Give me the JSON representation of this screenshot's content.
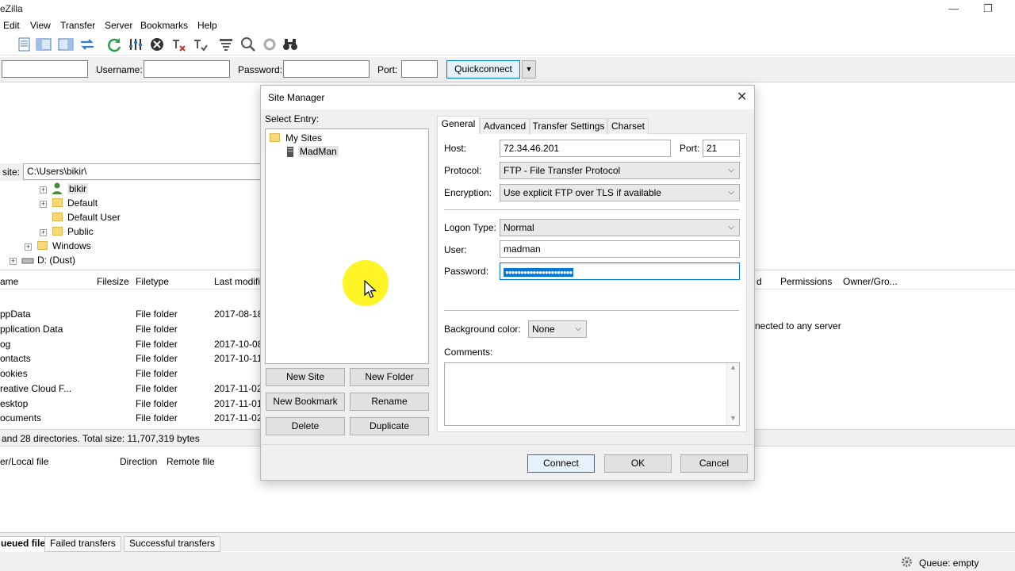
{
  "window": {
    "title": "eZilla"
  },
  "menu": [
    "Edit",
    "View",
    "Transfer",
    "Server",
    "Bookmarks",
    "Help"
  ],
  "quickconnect": {
    "username_label": "Username:",
    "password_label": "Password:",
    "port_label": "Port:",
    "button": "Quickconnect"
  },
  "local": {
    "site_label": "site:",
    "path": "C:\\Users\\bikir\\",
    "tree": [
      "bikir",
      "Default",
      "Default User",
      "Public",
      "Windows",
      "D: (Dust)"
    ],
    "columns": [
      "ame",
      "Filesize",
      "Filetype",
      "Last modifi"
    ],
    "rows": [
      {
        "name": "ppData",
        "type": "File folder",
        "date": "2017-08-18"
      },
      {
        "name": "pplication Data",
        "type": "File folder",
        "date": ""
      },
      {
        "name": "og",
        "type": "File folder",
        "date": "2017-10-08"
      },
      {
        "name": "ontacts",
        "type": "File folder",
        "date": "2017-10-11"
      },
      {
        "name": "ookies",
        "type": "File folder",
        "date": ""
      },
      {
        "name": "reative Cloud F...",
        "type": "File folder",
        "date": "2017-11-02"
      },
      {
        "name": "esktop",
        "type": "File folder",
        "date": "2017-11-01"
      },
      {
        "name": "ocuments",
        "type": "File folder",
        "date": "2017-11-02"
      }
    ],
    "status": "and 28 directories. Total size: 11,707,319 bytes"
  },
  "remote": {
    "columns": [
      "d",
      "Permissions",
      "Owner/Gro..."
    ],
    "message": "nected to any server"
  },
  "queue": {
    "columns": [
      "er/Local file",
      "Direction",
      "Remote file"
    ],
    "tabs": [
      "ueued files",
      "Failed transfers",
      "Successful transfers"
    ],
    "status": "Queue: empty"
  },
  "dialog": {
    "title": "Site Manager",
    "select_entry": "Select Entry:",
    "tree_root": "My Sites",
    "tree_child": "MadMan",
    "buttons": {
      "new_site": "New Site",
      "new_folder": "New Folder",
      "new_bookmark": "New Bookmark",
      "rename": "Rename",
      "delete": "Delete",
      "duplicate": "Duplicate",
      "connect": "Connect",
      "ok": "OK",
      "cancel": "Cancel"
    },
    "tabs": [
      "General",
      "Advanced",
      "Transfer Settings",
      "Charset"
    ],
    "host_label": "Host:",
    "host": "72.34.46.201",
    "port_label": "Port:",
    "port": "21",
    "protocol_label": "Protocol:",
    "protocol": "FTP - File Transfer Protocol",
    "encryption_label": "Encryption:",
    "encryption": "Use explicit FTP over TLS if available",
    "logon_label": "Logon Type:",
    "logon": "Normal",
    "user_label": "User:",
    "user": "madman",
    "password_label": "Password:",
    "password": "●●●●●●●●●●●●●●●●●●●●●●",
    "bgcolor_label": "Background color:",
    "bgcolor": "None",
    "comments_label": "Comments:"
  }
}
